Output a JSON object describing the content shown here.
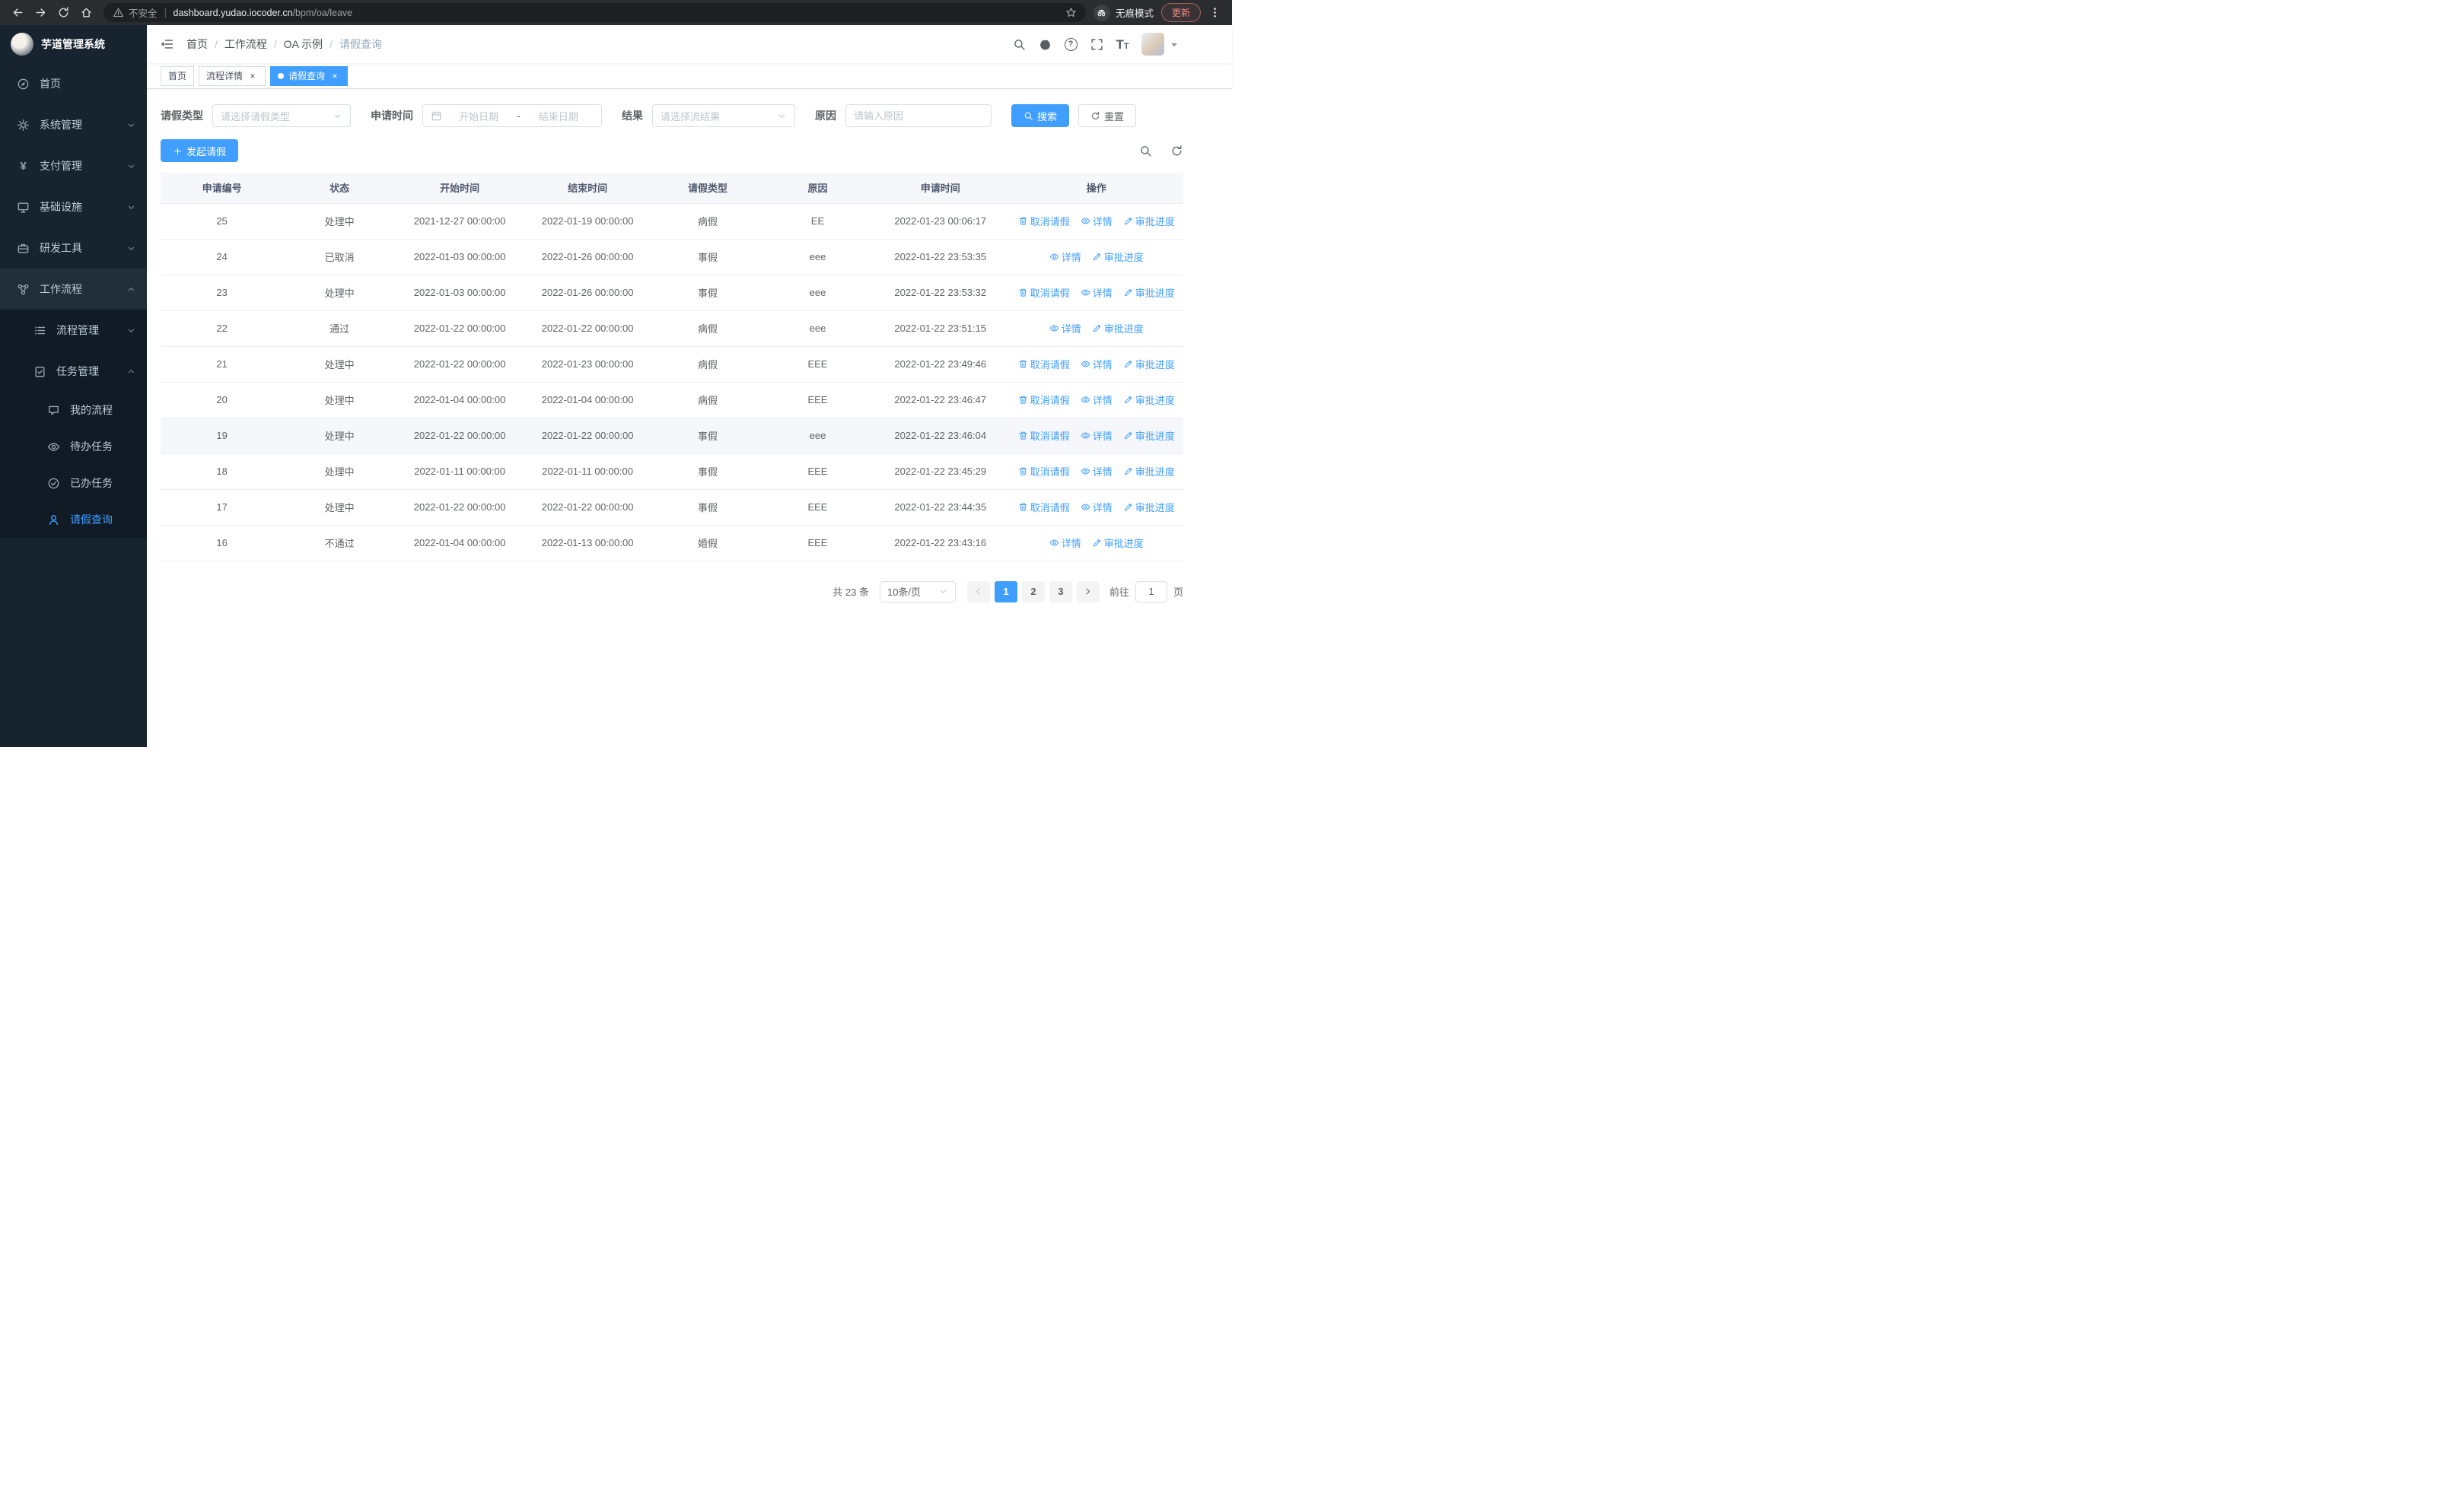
{
  "colors": {
    "primary": "#409eff",
    "sidebar_bg": "#17242f",
    "sidebar_sub_bg": "#101b25"
  },
  "icons": {
    "yen": "¥",
    "question": "?",
    "text_size_big": "T",
    "text_size_small": "T",
    "close": "×",
    "dash": "-"
  },
  "browser": {
    "security_warning": "不安全",
    "url_domain": "dashboard.yudao.iocoder.cn",
    "url_path": "/bpm/oa/leave",
    "incognito_label": "无痕模式",
    "update_label": "更新"
  },
  "sidebar": {
    "logo_title": "芋道管理系统",
    "items": [
      {
        "label": "首页"
      },
      {
        "label": "系统管理"
      },
      {
        "label": "支付管理"
      },
      {
        "label": "基础设施"
      },
      {
        "label": "研发工具"
      },
      {
        "label": "工作流程"
      }
    ],
    "workflow_children": [
      {
        "label": "流程管理"
      },
      {
        "label": "任务管理"
      }
    ],
    "task_children": [
      {
        "label": "我的流程"
      },
      {
        "label": "待办任务"
      },
      {
        "label": "已办任务"
      },
      {
        "label": "请假查询"
      }
    ]
  },
  "navbar": {
    "breadcrumb": [
      "首页",
      "工作流程",
      "OA 示例",
      "请假查询"
    ]
  },
  "tabs": [
    {
      "label": "首页"
    },
    {
      "label": "流程详情"
    },
    {
      "label": "请假查询"
    }
  ],
  "filters": {
    "leave_type_label": "请假类型",
    "leave_type_placeholder": "请选择请假类型",
    "apply_time_label": "申请时间",
    "start_date_placeholder": "开始日期",
    "date_separator": "-",
    "end_date_placeholder": "结束日期",
    "result_label": "结果",
    "result_placeholder": "请选择流结果",
    "reason_label": "原因",
    "reason_placeholder": "请输入原因",
    "search_button": "搜索",
    "reset_button": "重置"
  },
  "toolbar": {
    "create_button": "发起请假"
  },
  "table": {
    "columns": [
      "申请编号",
      "状态",
      "开始时间",
      "结束时间",
      "请假类型",
      "原因",
      "申请时间",
      "操作"
    ],
    "op_labels": {
      "cancel": "取消请假",
      "detail": "详情",
      "progress": "审批进度"
    },
    "rows": [
      {
        "id": "25",
        "status": "处理中",
        "start": "2021-12-27 00:00:00",
        "end": "2022-01-19 00:00:00",
        "type": "病假",
        "reason": "EE",
        "applied": "2022-01-23 00:06:17",
        "ops": [
          "cancel",
          "detail",
          "progress"
        ]
      },
      {
        "id": "24",
        "status": "已取消",
        "start": "2022-01-03 00:00:00",
        "end": "2022-01-26 00:00:00",
        "type": "事假",
        "reason": "eee",
        "applied": "2022-01-22 23:53:35",
        "ops": [
          "detail",
          "progress"
        ]
      },
      {
        "id": "23",
        "status": "处理中",
        "start": "2022-01-03 00:00:00",
        "end": "2022-01-26 00:00:00",
        "type": "事假",
        "reason": "eee",
        "applied": "2022-01-22 23:53:32",
        "ops": [
          "cancel",
          "detail",
          "progress"
        ]
      },
      {
        "id": "22",
        "status": "通过",
        "start": "2022-01-22 00:00:00",
        "end": "2022-01-22 00:00:00",
        "type": "病假",
        "reason": "eee",
        "applied": "2022-01-22 23:51:15",
        "ops": [
          "detail",
          "progress"
        ]
      },
      {
        "id": "21",
        "status": "处理中",
        "start": "2022-01-22 00:00:00",
        "end": "2022-01-23 00:00:00",
        "type": "病假",
        "reason": "EEE",
        "applied": "2022-01-22 23:49:46",
        "ops": [
          "cancel",
          "detail",
          "progress"
        ]
      },
      {
        "id": "20",
        "status": "处理中",
        "start": "2022-01-04 00:00:00",
        "end": "2022-01-04 00:00:00",
        "type": "病假",
        "reason": "EEE",
        "applied": "2022-01-22 23:46:47",
        "ops": [
          "cancel",
          "detail",
          "progress"
        ]
      },
      {
        "id": "19",
        "status": "处理中",
        "start": "2022-01-22 00:00:00",
        "end": "2022-01-22 00:00:00",
        "type": "事假",
        "reason": "eee",
        "applied": "2022-01-22 23:46:04",
        "ops": [
          "cancel",
          "detail",
          "progress"
        ],
        "highlight": true
      },
      {
        "id": "18",
        "status": "处理中",
        "start": "2022-01-11 00:00:00",
        "end": "2022-01-11 00:00:00",
        "type": "事假",
        "reason": "EEE",
        "applied": "2022-01-22 23:45:29",
        "ops": [
          "cancel",
          "detail",
          "progress"
        ]
      },
      {
        "id": "17",
        "status": "处理中",
        "start": "2022-01-22 00:00:00",
        "end": "2022-01-22 00:00:00",
        "type": "事假",
        "reason": "EEE",
        "applied": "2022-01-22 23:44:35",
        "ops": [
          "cancel",
          "detail",
          "progress"
        ]
      },
      {
        "id": "16",
        "status": "不通过",
        "start": "2022-01-04 00:00:00",
        "end": "2022-01-13 00:00:00",
        "type": "婚假",
        "reason": "EEE",
        "applied": "2022-01-22 23:43:16",
        "ops": [
          "detail",
          "progress"
        ]
      }
    ]
  },
  "pagination": {
    "total_text": "共 23 条",
    "page_size": "10条/页",
    "pages": [
      "1",
      "2",
      "3"
    ],
    "goto_label": "前往",
    "goto_value": "1",
    "goto_suffix": "页"
  }
}
